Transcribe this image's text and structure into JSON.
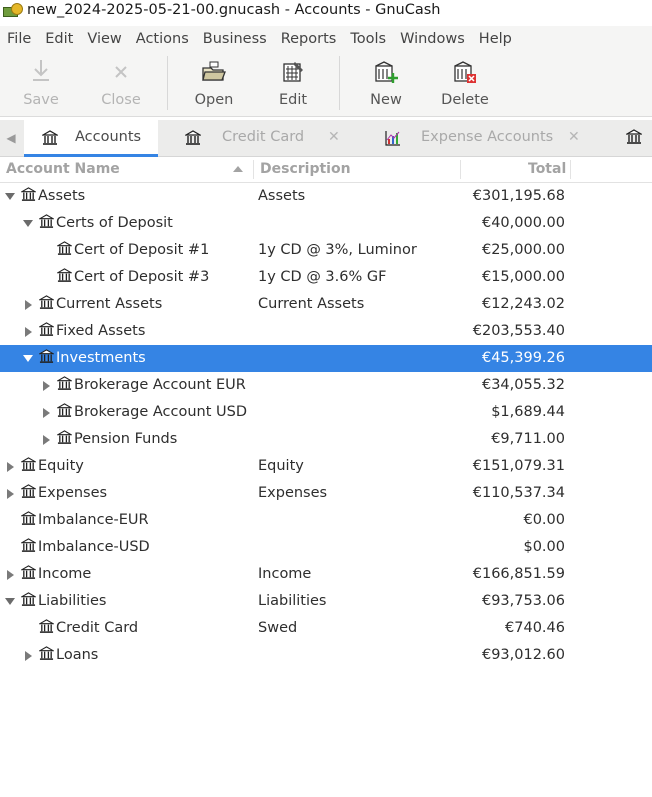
{
  "window": {
    "title": "new_2024-2025-05-21-00.gnucash - Accounts - GnuCash"
  },
  "menubar": {
    "items": [
      "File",
      "Edit",
      "View",
      "Actions",
      "Business",
      "Reports",
      "Tools",
      "Windows",
      "Help"
    ]
  },
  "toolbar": {
    "save_label": "Save",
    "close_label": "Close",
    "open_label": "Open",
    "edit_label": "Edit",
    "new_label": "New",
    "delete_label": "Delete"
  },
  "tabs": [
    {
      "label": "Accounts",
      "active": true
    },
    {
      "label": "Credit Card",
      "active": false
    },
    {
      "label": "Expense Accounts",
      "active": false
    }
  ],
  "columns": {
    "name": "Account Name",
    "description": "Description",
    "total": "Total"
  },
  "accounts": [
    {
      "name": "Assets",
      "description": "Assets",
      "total": "€301,195.68"
    },
    {
      "name": "Certs of Deposit",
      "description": "",
      "total": "€40,000.00"
    },
    {
      "name": "Cert of Deposit #1",
      "description": "1y CD @ 3%, Luminor",
      "total": "€25,000.00"
    },
    {
      "name": "Cert of Deposit #3",
      "description": "1y CD @ 3.6% GF",
      "total": "€15,000.00"
    },
    {
      "name": "Current Assets",
      "description": "Current Assets",
      "total": "€12,243.02"
    },
    {
      "name": "Fixed Assets",
      "description": "",
      "total": "€203,553.40"
    },
    {
      "name": "Investments",
      "description": "",
      "total": "€45,399.26"
    },
    {
      "name": "Brokerage Account EUR",
      "description": "",
      "total": "€34,055.32"
    },
    {
      "name": "Brokerage Account USD",
      "description": "",
      "total": "$1,689.44"
    },
    {
      "name": "Pension Funds",
      "description": "",
      "total": "€9,711.00"
    },
    {
      "name": "Equity",
      "description": "Equity",
      "total": "€151,079.31"
    },
    {
      "name": "Expenses",
      "description": "Expenses",
      "total": "€110,537.34"
    },
    {
      "name": "Imbalance-EUR",
      "description": "",
      "total": "€0.00"
    },
    {
      "name": "Imbalance-USD",
      "description": "",
      "total": "$0.00"
    },
    {
      "name": "Income",
      "description": "Income",
      "total": "€166,851.59"
    },
    {
      "name": "Liabilities",
      "description": "Liabilities",
      "total": "€93,753.06"
    },
    {
      "name": "Credit Card",
      "description": "Swed",
      "total": "€740.46"
    },
    {
      "name": "Loans",
      "description": "",
      "total": "€93,012.60"
    }
  ],
  "colors": {
    "selection": "#3584e4",
    "toolbar_bg": "#f5f5f4"
  }
}
